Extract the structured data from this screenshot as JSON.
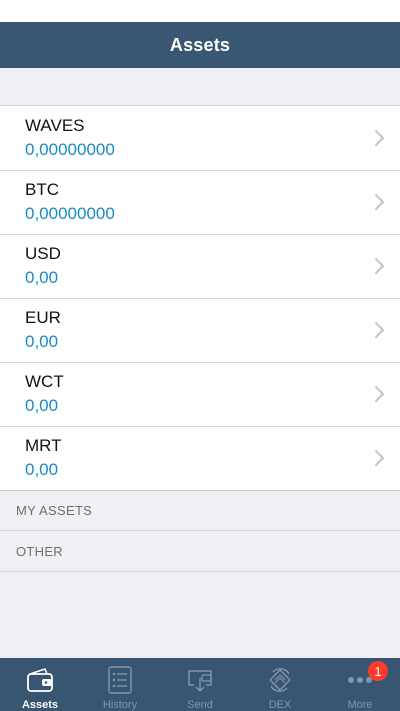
{
  "nav": {
    "title": "Assets"
  },
  "assets": [
    {
      "name": "WAVES",
      "amount": "0,00000000"
    },
    {
      "name": "BTC",
      "amount": "0,00000000"
    },
    {
      "name": "USD",
      "amount": "0,00"
    },
    {
      "name": "EUR",
      "amount": "0,00"
    },
    {
      "name": "WCT",
      "amount": "0,00"
    },
    {
      "name": "MRT",
      "amount": "0,00"
    }
  ],
  "sections": {
    "my_assets": "MY ASSETS",
    "other": "OTHER"
  },
  "tabs": [
    {
      "label": "Assets",
      "icon": "wallet-icon",
      "active": true
    },
    {
      "label": "History",
      "icon": "list-icon"
    },
    {
      "label": "Send",
      "icon": "send-icon"
    },
    {
      "label": "DEX",
      "icon": "exchange-icon"
    },
    {
      "label": "More",
      "icon": "more-icon",
      "badge": "1"
    }
  ],
  "colors": {
    "nav_bg": "#395672",
    "amount": "#1a8bc2",
    "badge": "#ff3b30"
  }
}
